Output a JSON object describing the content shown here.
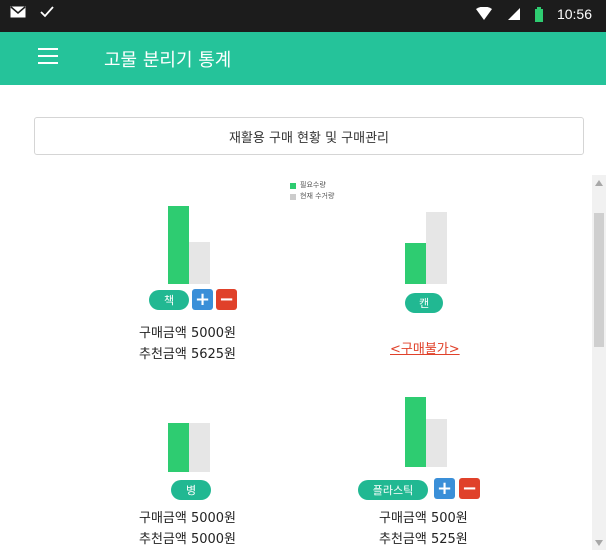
{
  "status_bar": {
    "time": "10:56"
  },
  "app_bar": {
    "title": "고물 분리기 통계"
  },
  "header": {
    "text": "재활용 구매 현황 및 구매관리"
  },
  "legend": {
    "need_label": "필요수량",
    "current_label": "현재 수거량",
    "need_color": "#2ecc71",
    "current_color": "#cccccc"
  },
  "items": [
    {
      "name": "책",
      "need_level": 0.87,
      "current_level": 0.47,
      "price_line": "구매금액 5000원",
      "recommend_line": "추천금액 5625원"
    },
    {
      "name": "캔",
      "need_level": 0.46,
      "current_level": 0.8,
      "unavailable": "<구매불가>"
    },
    {
      "name": "병",
      "need_level": 0.55,
      "current_level": 0.55,
      "price_line": "구매금액 5000원",
      "recommend_line": "추천금액 5000원"
    },
    {
      "name": "플라스틱",
      "need_level": 0.78,
      "current_level": 0.53,
      "price_line": "구매금액 500원",
      "recommend_line": "추천금액 525원"
    }
  ],
  "controls": {
    "plus": "+",
    "minus": "−"
  }
}
